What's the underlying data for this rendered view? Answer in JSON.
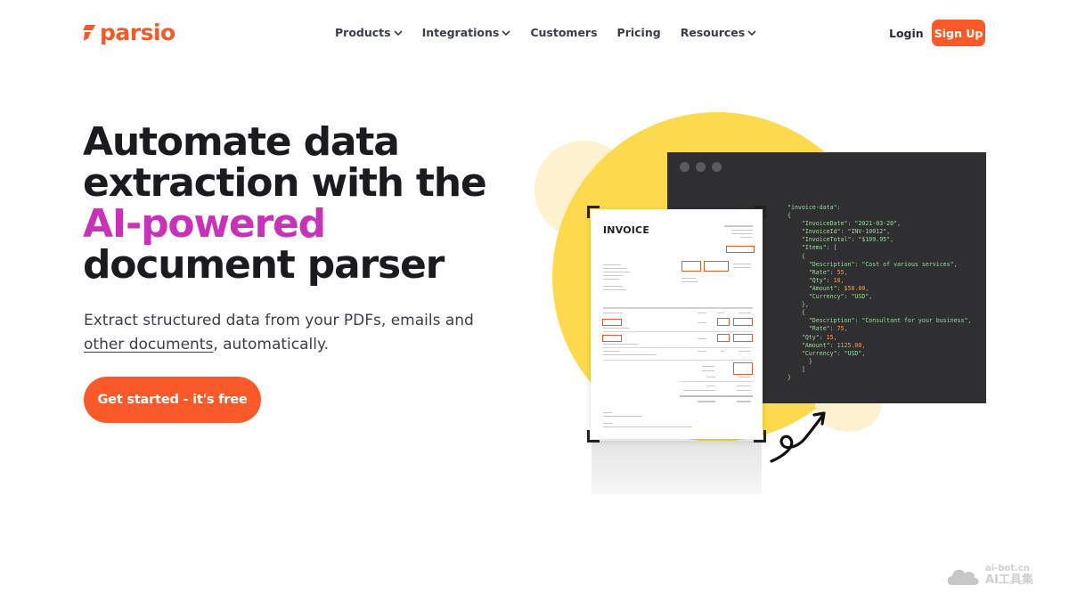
{
  "brand": {
    "name": "parsio",
    "color": "#f15a29"
  },
  "nav": {
    "items": [
      {
        "label": "Products",
        "has_dropdown": true
      },
      {
        "label": "Integrations",
        "has_dropdown": true
      },
      {
        "label": "Customers",
        "has_dropdown": false
      },
      {
        "label": "Pricing",
        "has_dropdown": false
      },
      {
        "label": "Resources",
        "has_dropdown": true
      }
    ],
    "login": "Login",
    "signup": "Sign Up"
  },
  "hero": {
    "title_line1": "Automate data",
    "title_line2": "extraction with the",
    "title_accent": "AI-powered",
    "title_line4": "document parser",
    "subtitle_before": "Extract structured data from your PDFs, emails and",
    "subtitle_link": "other documents",
    "subtitle_after": ", automatically.",
    "cta": "Get started - it's free",
    "accent_color": "#c931b9",
    "cta_color": "#fa5a29"
  },
  "illustration": {
    "invoice_title": "INVOICE",
    "code_lines": [
      "\"invoice-data\":",
      "{",
      "    \"InvoiceDate\": \"2021-03-20\",",
      "    \"InvoiceId\": \"INV-10012\",",
      "    \"InvoiceTotal\": \"$109.95\",",
      "    \"Items\": [",
      "    {",
      "      \"Description\": \"Cost of various services\",",
      "      \"Rate\": 55,",
      "      \"Qty\": 10,",
      "      \"Amount\": $50.00,",
      "      \"Currency\": \"USD\",",
      "    },",
      "    {",
      "      \"Description\": \"Consultant for your business\",",
      "      \"Rate\": 75,",
      "    \"Qty\": 15,",
      "    \"Amount\": 1125.00,",
      "    \"Currency\": \"USD\",",
      "      }",
      "    ]",
      "}"
    ]
  },
  "watermark": {
    "line1": "ai-bot.cn",
    "line2": "AI工具集"
  }
}
